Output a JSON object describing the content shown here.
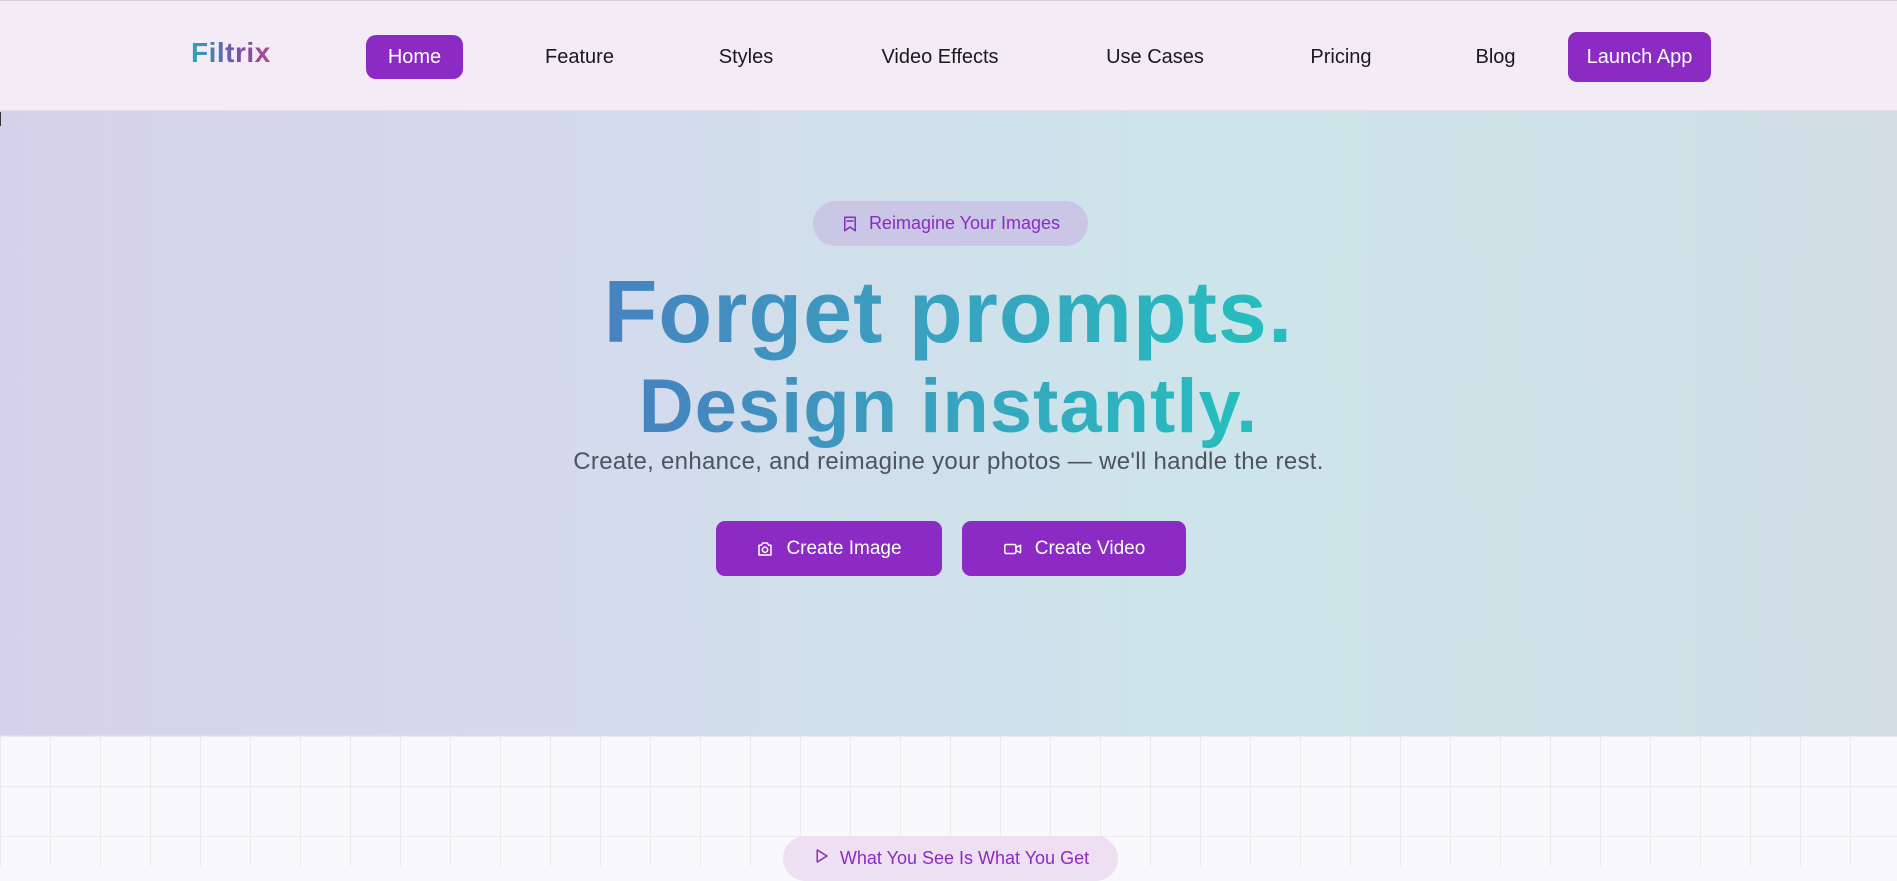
{
  "brand": {
    "name": "Filtrix"
  },
  "nav": {
    "items": [
      {
        "label": "Home",
        "active": true
      },
      {
        "label": "Feature",
        "active": false
      },
      {
        "label": "Styles",
        "active": false
      },
      {
        "label": "Video Effects",
        "active": false
      },
      {
        "label": "Use Cases",
        "active": false
      },
      {
        "label": "Pricing",
        "active": false
      },
      {
        "label": "Blog",
        "active": false
      }
    ],
    "cta_label": "Launch App"
  },
  "hero": {
    "badge": {
      "label": "Reimagine Your Images",
      "icon": "bookmark-icon"
    },
    "headline_line1": "Forget prompts.",
    "headline_line2": "Design instantly.",
    "subtitle": "Create, enhance, and reimagine your photos — we'll handle the rest.",
    "buttons": [
      {
        "label": "Create Image",
        "icon": "camera-icon"
      },
      {
        "label": "Create Video",
        "icon": "video-icon"
      }
    ]
  },
  "section2": {
    "badge": {
      "label": "What You See Is What You Get",
      "icon": "play-icon"
    }
  },
  "colors": {
    "accent": "#8b2bc4",
    "headline_gradient_start": "#4682bf",
    "headline_gradient_end": "#25bfbd"
  }
}
